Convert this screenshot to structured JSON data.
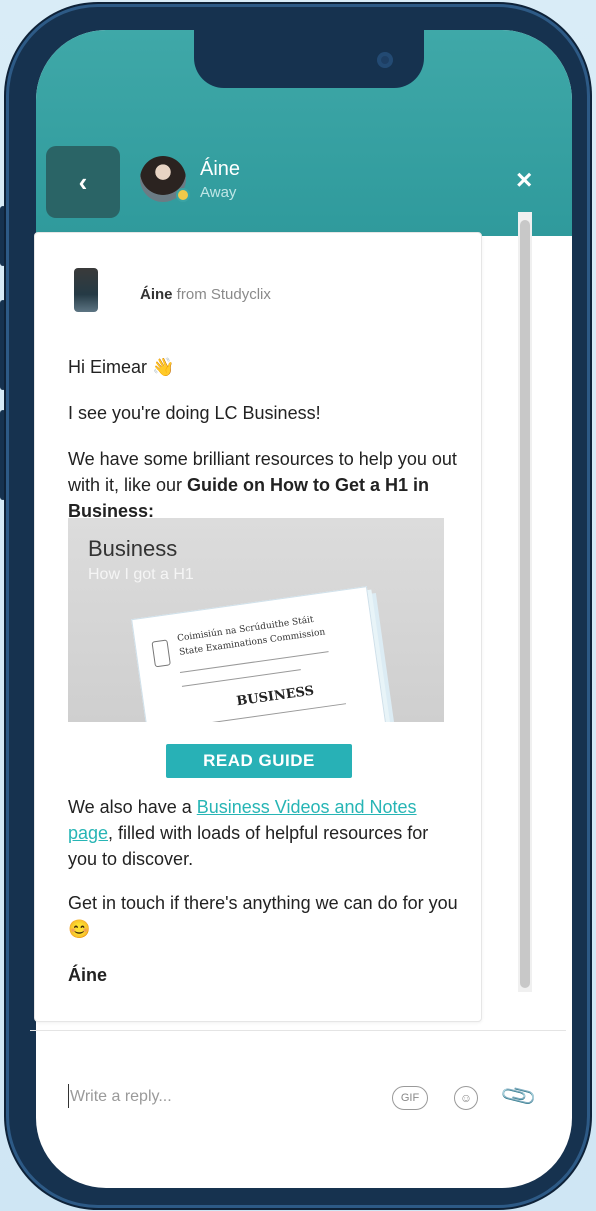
{
  "header": {
    "agent_name": "Áine",
    "agent_status": "Away",
    "back_symbol": "‹",
    "close_symbol": "×"
  },
  "message": {
    "sender_name": "Áine",
    "sender_from": " from Studyclix",
    "greeting": "Hi Eimear",
    "greeting_emoji": "👋",
    "line1": "I see you're doing LC Business!",
    "line2_plain": "We have some brilliant resources to help you out with it, like our ",
    "line2_bold": "Guide on How to Get a H1 in Business:",
    "guide_image": {
      "title": "Business",
      "subtitle": "How I got a H1",
      "paper_line1": "Coimisiún na Scrúduithe Stáit",
      "paper_line2": "State Examinations Commission",
      "paper_subject": "BUSINESS"
    },
    "read_button": "READ GUIDE",
    "line3_before": "We also have a ",
    "line3_link": "Business Videos and Notes page",
    "line3_after": ", filled with loads of helpful resources for you to discover.",
    "line4": "Get in touch if there's anything we can do for you",
    "line4_emoji": "😊",
    "signature": "Áine"
  },
  "composer": {
    "placeholder": "Write a reply...",
    "gif_label": "GIF",
    "emoji_icon": "☺",
    "attach_icon": "📎"
  },
  "colors": {
    "header": "#2f9a9c",
    "button": "#28b1b6",
    "link": "#27b5b5",
    "frame": "#16324f"
  }
}
